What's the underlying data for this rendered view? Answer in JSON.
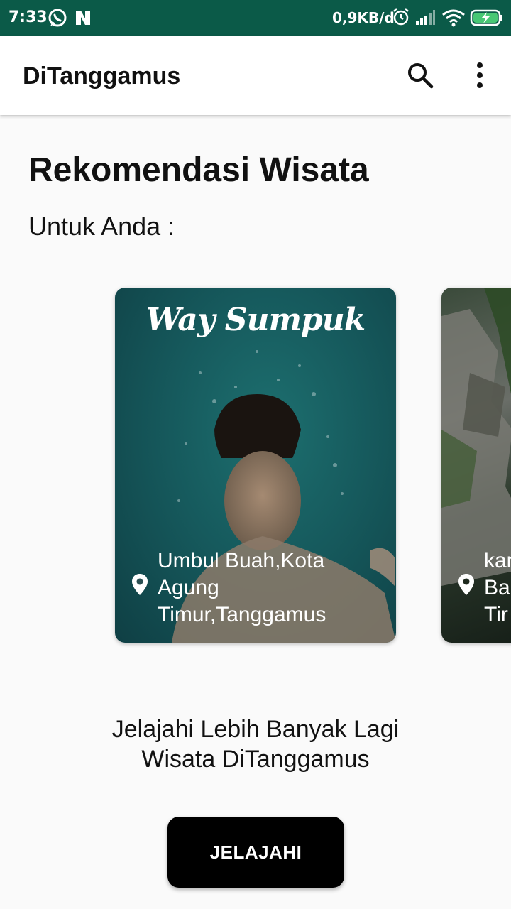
{
  "status_bar": {
    "time": "7:33",
    "network_speed": "0,9KB/d",
    "icons": [
      "whatsapp-icon",
      "n-notification-icon",
      "alarm-icon",
      "signal-icon",
      "wifi-icon",
      "battery-charging-icon"
    ],
    "background": "#0b5a48"
  },
  "app_bar": {
    "title": "DiTanggamus",
    "actions": [
      "search-icon",
      "more-vert-icon"
    ]
  },
  "main": {
    "heading": "Rekomendasi Wisata",
    "subheading": "Untuk Anda :",
    "cards": [
      {
        "title": "Way Sumpuk",
        "location_lines": [
          "Umbul Buah,Kota",
          "Agung",
          "Timur,Tanggamus"
        ]
      },
      {
        "title": "",
        "location_lines": [
          "kar",
          "Ba",
          "Tir"
        ]
      }
    ],
    "explore_text_lines": [
      "Jelajahi Lebih Banyak Lagi",
      "Wisata DiTanggamus"
    ],
    "explore_button_label": "JELAJAHI"
  }
}
